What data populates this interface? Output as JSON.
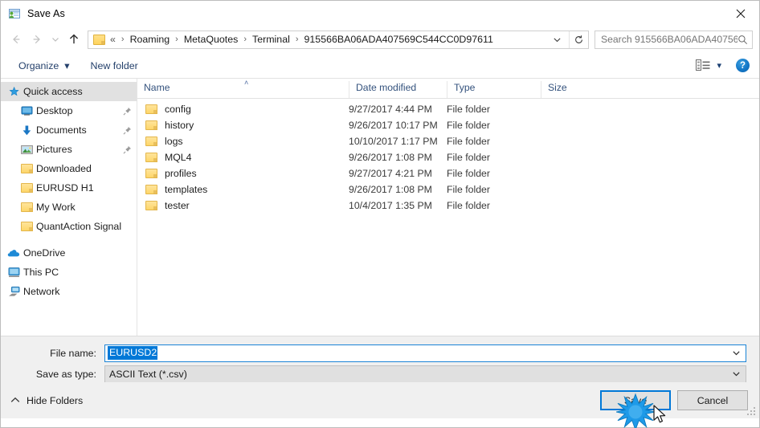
{
  "window": {
    "title": "Save As",
    "icon": "save-as-window-icon",
    "close_label": "✕"
  },
  "nav": {
    "back_icon": "arrow-left-icon",
    "forward_icon": "arrow-right-icon",
    "recent_icon": "chevron-down-icon",
    "up_icon": "arrow-up-icon",
    "refresh_icon": "refresh-icon",
    "address_chevron_icon": "chevron-down-icon",
    "breadcrumbs": [
      {
        "label": "«"
      },
      {
        "label": "Roaming"
      },
      {
        "label": "MetaQuotes"
      },
      {
        "label": "Terminal"
      },
      {
        "label": "915566BA06ADA407569C544CC0D97611"
      }
    ],
    "separator": "›"
  },
  "search": {
    "placeholder": "Search 915566BA06ADA40756...",
    "value": "",
    "icon": "search-icon"
  },
  "toolbar": {
    "organize_label": "Organize",
    "organize_caret": "▾",
    "new_folder_label": "New folder",
    "view_icon": "view-layout-icon",
    "view_caret": "▾",
    "help_label": "?",
    "help_icon": "help-icon"
  },
  "sidebar": {
    "items": [
      {
        "label": "Quick access",
        "icon": "star-pin-icon",
        "level": 0,
        "selected": true,
        "pinned": false
      },
      {
        "label": "Desktop",
        "icon": "desktop-icon",
        "level": 1,
        "selected": false,
        "pinned": true
      },
      {
        "label": "Documents",
        "icon": "documents-download-icon",
        "level": 1,
        "selected": false,
        "pinned": true
      },
      {
        "label": "Pictures",
        "icon": "pictures-icon",
        "level": 1,
        "selected": false,
        "pinned": true
      },
      {
        "label": "Downloaded",
        "icon": "folder-icon",
        "level": 1,
        "selected": false,
        "pinned": false
      },
      {
        "label": "EURUSD H1",
        "icon": "folder-icon",
        "level": 1,
        "selected": false,
        "pinned": false
      },
      {
        "label": "My Work",
        "icon": "folder-icon",
        "level": 1,
        "selected": false,
        "pinned": false
      },
      {
        "label": "QuantAction Signal",
        "icon": "folder-icon",
        "level": 1,
        "selected": false,
        "pinned": false
      }
    ],
    "roots": [
      {
        "label": "OneDrive",
        "icon": "onedrive-cloud-icon"
      },
      {
        "label": "This PC",
        "icon": "this-pc-icon"
      },
      {
        "label": "Network",
        "icon": "network-icon"
      }
    ]
  },
  "filelist": {
    "columns": [
      "Name",
      "Date modified",
      "Type",
      "Size"
    ],
    "sort_indicator": "˄",
    "rows": [
      {
        "name": "config",
        "date": "9/27/2017 4:44 PM",
        "type": "File folder",
        "size": ""
      },
      {
        "name": "history",
        "date": "9/26/2017 10:17 PM",
        "type": "File folder",
        "size": ""
      },
      {
        "name": "logs",
        "date": "10/10/2017 1:17 PM",
        "type": "File folder",
        "size": ""
      },
      {
        "name": "MQL4",
        "date": "9/26/2017 1:08 PM",
        "type": "File folder",
        "size": ""
      },
      {
        "name": "profiles",
        "date": "9/27/2017 4:21 PM",
        "type": "File folder",
        "size": ""
      },
      {
        "name": "templates",
        "date": "9/26/2017 1:08 PM",
        "type": "File folder",
        "size": ""
      },
      {
        "name": "tester",
        "date": "10/4/2017 1:35 PM",
        "type": "File folder",
        "size": ""
      }
    ]
  },
  "form": {
    "filename_label": "File name:",
    "filename_value": "EURUSD2",
    "filetype_label": "Save as type:",
    "filetype_value": "ASCII Text (*.csv)",
    "caret_icon": "chevron-down-icon"
  },
  "footer": {
    "hide_folders_label": "Hide Folders",
    "hide_folders_icon": "chevron-up-icon",
    "save_label": "Save",
    "cancel_label": "Cancel",
    "resize_grip_icon": "resize-grip-icon"
  },
  "pointer": {
    "click_burst_icon": "click-burst-icon",
    "cursor_icon": "mouse-pointer-icon",
    "burst_color": "#1e9ae8"
  },
  "colors": {
    "accent": "#0078d7",
    "selection": "#0078d7",
    "breadcrumb_text": "#1b1b1b",
    "header_text": "#34527d",
    "folder_yellow": "#fdd66a"
  }
}
